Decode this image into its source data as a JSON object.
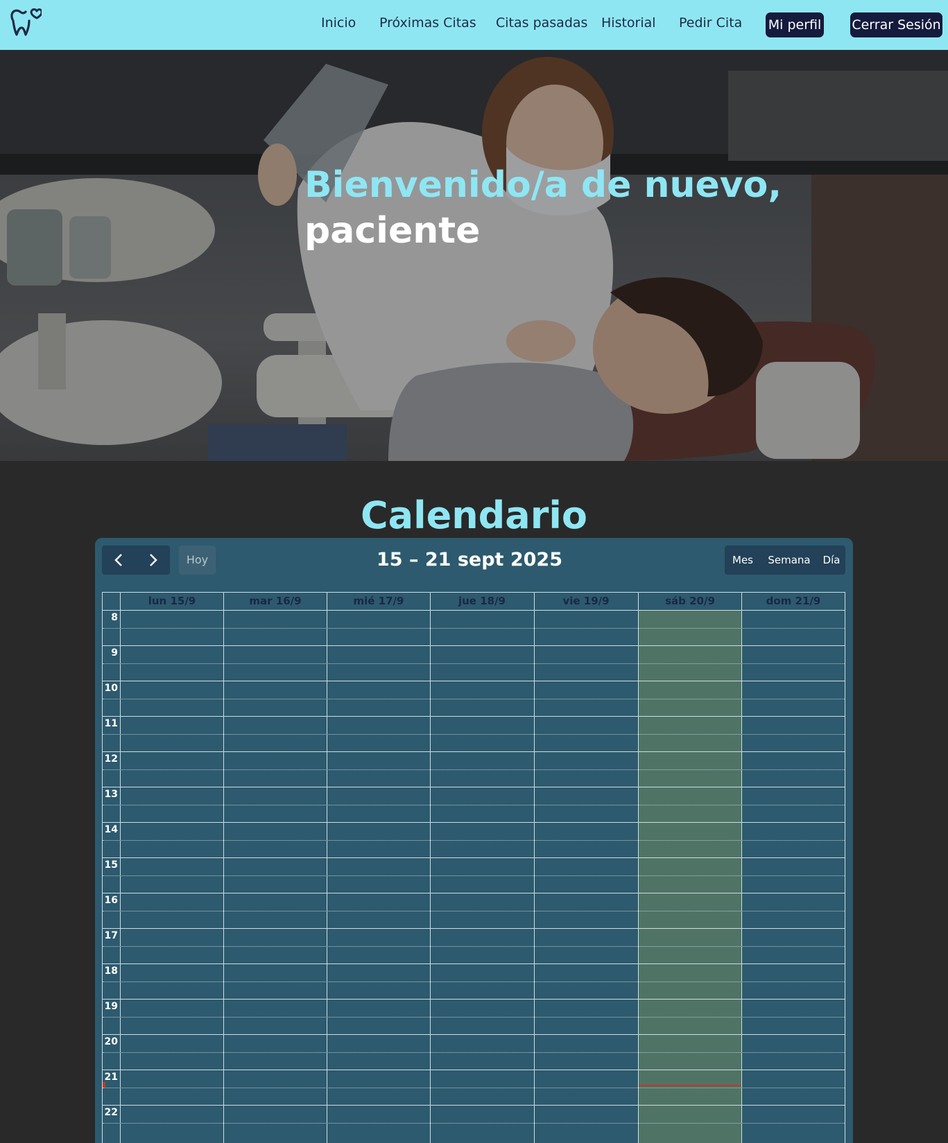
{
  "navbar": {
    "logo": "tooth-heart-logo-icon",
    "links": [
      "Inicio",
      "Próximas Citas",
      "Citas pasadas",
      "Historial",
      "Pedir Cita"
    ],
    "profile_button": "Mi perfil",
    "logout_button": "Cerrar Sesión",
    "colors": {
      "background": "#8fe6f3",
      "button": "#151b3d"
    }
  },
  "hero": {
    "greeting": "Bienvenido/a de nuevo,",
    "name": "paciente"
  },
  "calendar": {
    "heading": "Calendario",
    "prev_icon": "chevron-left-icon",
    "next_icon": "chevron-right-icon",
    "today_label": "Hoy",
    "range_title": "15 – 21 sept 2025",
    "views": [
      "Mes",
      "Semana",
      "Día"
    ],
    "active_view": "Semana",
    "days": [
      "lun 15/9",
      "mar 16/9",
      "mié 17/9",
      "jue 18/9",
      "vie 19/9",
      "sáb 20/9",
      "dom 21/9"
    ],
    "today_day": "sáb 20/9",
    "hours": [
      "8",
      "9",
      "10",
      "11",
      "12",
      "13",
      "14",
      "15",
      "16",
      "17",
      "18",
      "19",
      "20",
      "21",
      "22"
    ],
    "colors": {
      "panel": "#2d5a6e",
      "today_highlight": "#4f7465",
      "now_indicator": "#c0392b"
    }
  }
}
